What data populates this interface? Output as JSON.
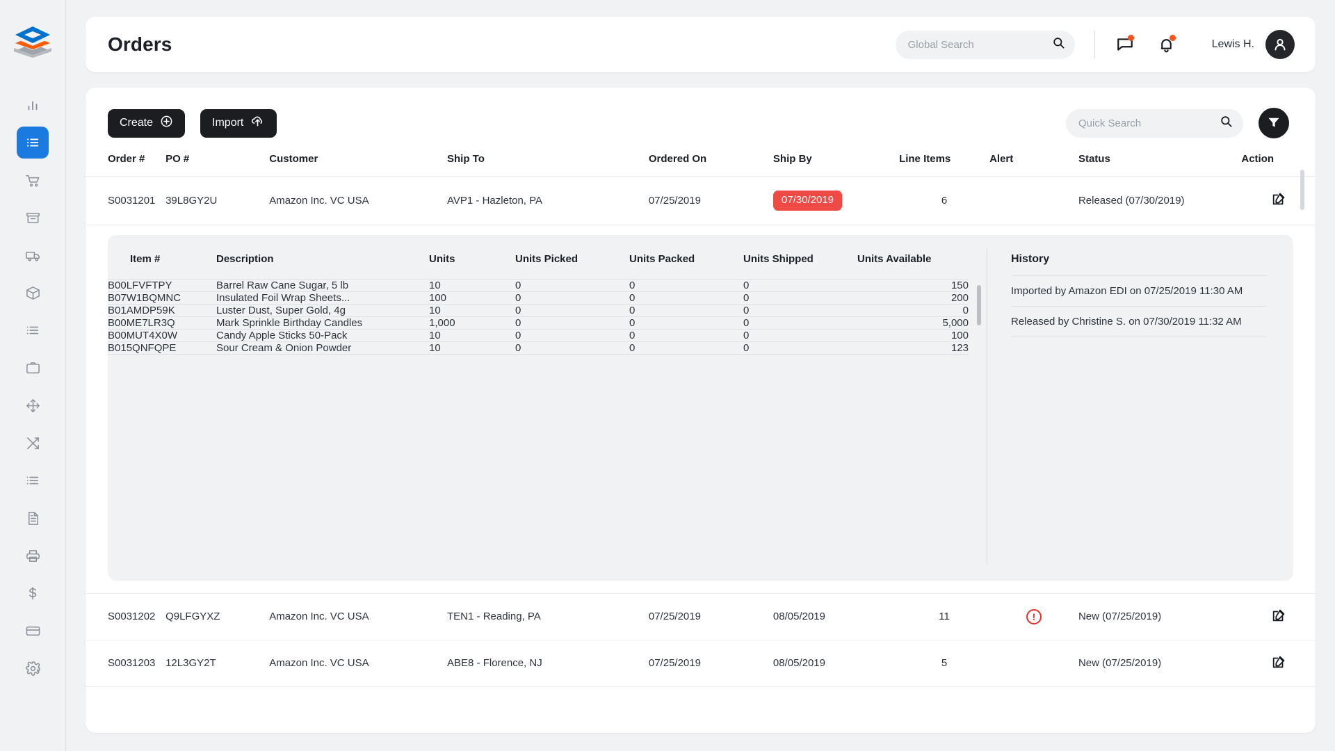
{
  "brand": {
    "logo_name": "stackline-layers-logo"
  },
  "sidebar": {
    "items": [
      {
        "icon": "bar-chart-icon",
        "name": "analytics",
        "active": false
      },
      {
        "icon": "list-icon",
        "name": "orders",
        "active": true
      },
      {
        "icon": "shopping-cart-icon",
        "name": "purchasing",
        "active": false
      },
      {
        "icon": "inbox-icon",
        "name": "receiving",
        "active": false
      },
      {
        "icon": "truck-icon",
        "name": "shipping",
        "active": false
      },
      {
        "icon": "box-icon",
        "name": "inventory",
        "active": false
      },
      {
        "icon": "bullet-list-icon",
        "name": "picklists",
        "active": false
      },
      {
        "icon": "clipboard-icon",
        "name": "tasks",
        "active": false
      },
      {
        "icon": "move-icon",
        "name": "moves",
        "active": false
      },
      {
        "icon": "shuffle-icon",
        "name": "transfers",
        "active": false
      },
      {
        "icon": "bullet-list-icon",
        "name": "counts",
        "active": false
      },
      {
        "icon": "document-icon",
        "name": "reports",
        "active": false
      },
      {
        "icon": "printer-icon",
        "name": "printing",
        "active": false
      },
      {
        "icon": "dollar-icon",
        "name": "billing",
        "active": false
      },
      {
        "icon": "credit-card-icon",
        "name": "payments",
        "active": false
      },
      {
        "icon": "gear-icon",
        "name": "settings",
        "active": false
      }
    ]
  },
  "header": {
    "title": "Orders",
    "global_search": {
      "value": "",
      "placeholder": "Global Search",
      "icon": "search-icon"
    },
    "messages_icon": "chat-bubble-icon",
    "notifications_icon": "bell-icon",
    "user_name": "Lewis H.",
    "avatar_icon": "user-avatar-icon",
    "accent_dot_color": "#f4521f"
  },
  "toolbar": {
    "create_label": "Create",
    "create_icon": "plus-circle-icon",
    "import_label": "Import",
    "import_icon": "cloud-upload-icon",
    "quick_search": {
      "value": "",
      "placeholder": "Quick Search",
      "icon": "search-icon"
    },
    "filter_icon": "funnel-icon"
  },
  "orders_table": {
    "columns": [
      "Order #",
      "PO #",
      "Customer",
      "Ship To",
      "Ordered On",
      "Ship By",
      "Line Items",
      "Alert",
      "Status",
      "Action"
    ],
    "rows": [
      {
        "order": "S0031201",
        "po": "39L8GY2U",
        "customer": "Amazon Inc. VC USA",
        "ship_to": "AVP1 - Hazleton, PA",
        "ordered_on": "07/25/2019",
        "ship_by": "07/30/2019",
        "ship_by_highlight": true,
        "line_items": "6",
        "alert": "",
        "status": "Released (07/30/2019)",
        "action_icon": "edit-icon",
        "expanded": true
      },
      {
        "order": "S0031202",
        "po": "Q9LFGYXZ",
        "customer": "Amazon Inc. VC USA",
        "ship_to": "TEN1 - Reading, PA",
        "ordered_on": "07/25/2019",
        "ship_by": "08/05/2019",
        "ship_by_highlight": false,
        "line_items": "11",
        "alert": "!",
        "status": "New (07/25/2019)",
        "action_icon": "edit-icon",
        "expanded": false
      },
      {
        "order": "S0031203",
        "po": "12L3GY2T",
        "customer": "Amazon Inc. VC USA",
        "ship_to": "ABE8 - Florence, NJ",
        "ordered_on": "07/25/2019",
        "ship_by": "08/05/2019",
        "ship_by_highlight": false,
        "line_items": "5",
        "alert": "",
        "status": "New (07/25/2019)",
        "action_icon": "edit-icon",
        "expanded": false
      }
    ],
    "ship_by_badge_color": "#ef4a46",
    "alert_color": "#e8302c"
  },
  "detail": {
    "items_columns": [
      "Item #",
      "Description",
      "Units",
      "Units Picked",
      "Units Packed",
      "Units Shipped",
      "Units Available"
    ],
    "items": [
      {
        "item": "B00LFVFTPY",
        "description": "Barrel Raw Cane Sugar, 5 lb",
        "units": "10",
        "picked": "0",
        "packed": "0",
        "shipped": "0",
        "available": "150"
      },
      {
        "item": "B07W1BQMNC",
        "description": "Insulated Foil Wrap Sheets...",
        "units": "100",
        "picked": "0",
        "packed": "0",
        "shipped": "0",
        "available": "200"
      },
      {
        "item": "B01AMDP59K",
        "description": "Luster Dust, Super Gold, 4g",
        "units": "10",
        "picked": "0",
        "packed": "0",
        "shipped": "0",
        "available": "0"
      },
      {
        "item": "B00ME7LR3Q",
        "description": "Mark Sprinkle Birthday Candles",
        "units": "1,000",
        "picked": "0",
        "packed": "0",
        "shipped": "0",
        "available": "5,000"
      },
      {
        "item": "B00MUT4X0W",
        "description": "Candy Apple Sticks 50-Pack",
        "units": "10",
        "picked": "0",
        "packed": "0",
        "shipped": "0",
        "available": "100"
      },
      {
        "item": "B015QNFQPE",
        "description": "Sour Cream & Onion Powder",
        "units": "10",
        "picked": "0",
        "packed": "0",
        "shipped": "0",
        "available": "123"
      }
    ],
    "history_title": "History",
    "history": [
      "Imported by Amazon EDI on 07/25/2019 11:30 AM",
      "Released by Christine S. on 07/30/2019 11:32 AM"
    ]
  }
}
